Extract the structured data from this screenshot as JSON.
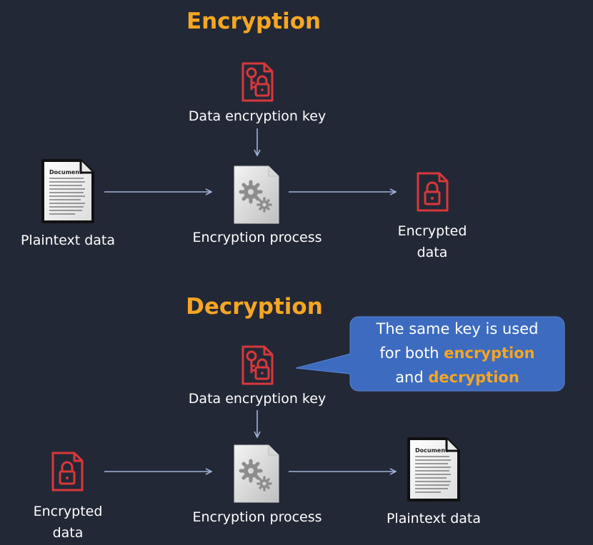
{
  "encryption": {
    "title": "Encryption",
    "key_label": "Data encryption key",
    "input_label": "Plaintext data",
    "process_label": "Encryption process",
    "output_label_line1": "Encrypted",
    "output_label_line2": "data"
  },
  "decryption": {
    "title": "Decryption",
    "key_label": "Data encryption key",
    "input_label_line1": "Encrypted",
    "input_label_line2": "data",
    "process_label": "Encryption process",
    "output_label": "Plaintext data"
  },
  "callout": {
    "line1": "The same key is used",
    "line2_prefix": "for both ",
    "line2_highlight": "encryption",
    "line3_prefix": "and ",
    "line3_highlight": "decryption"
  },
  "document_icon": {
    "heading": "Document"
  },
  "colors": {
    "background": "#232836",
    "title_accent": "#f5a623",
    "key_icon_red": "#d9383a",
    "arrow": "#9fb4d8",
    "callout_fill": "#3d6bbf"
  },
  "icons": [
    "key-lock-file-icon",
    "document-icon",
    "gear-file-icon",
    "lock-file-icon",
    "arrow-icon"
  ]
}
